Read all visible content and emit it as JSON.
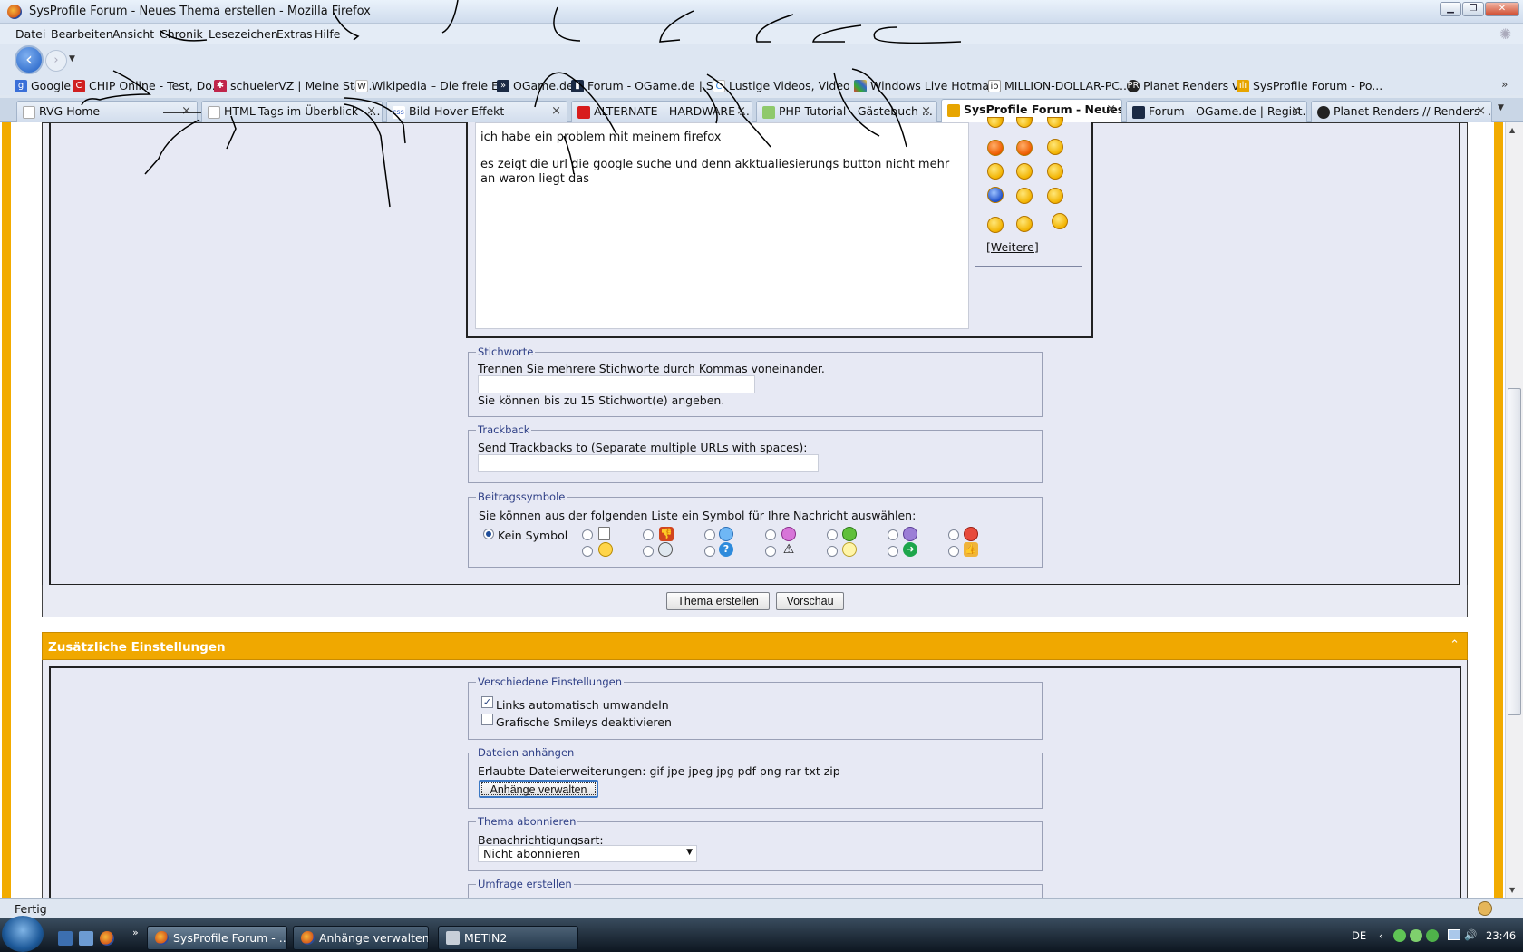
{
  "window": {
    "title": "SysProfile Forum - Neues Thema erstellen - Mozilla Firefox"
  },
  "menubar": [
    "Datei",
    "Bearbeiten",
    "Ansicht",
    "Chronik",
    "Lesezeichen",
    "Extras",
    "Hilfe"
  ],
  "bookmarks": [
    {
      "label": "Google",
      "icon": "google-icon",
      "color": "#3a6fd8"
    },
    {
      "label": "CHIP Online - Test, Do...",
      "icon": "chip-icon",
      "color": "#d02020"
    },
    {
      "label": "schuelerVZ | Meine Sta...",
      "icon": "schuelervz-icon",
      "color": "#c0254a"
    },
    {
      "label": "Wikipedia – Die freie E...",
      "icon": "wikipedia-icon",
      "color": "#444444"
    },
    {
      "label": "OGame.de",
      "icon": "ogame-icon",
      "color": "#1b2a44"
    },
    {
      "label": "Forum - OGame.de | S...",
      "icon": "ogame-forum-icon",
      "color": "#1b2a44"
    },
    {
      "label": "Lustige Videos, Video ...",
      "icon": "video-icon",
      "color": "#3c8be0"
    },
    {
      "label": "Windows Live Hotmail",
      "icon": "windows-icon",
      "color": "#2b7fd8"
    },
    {
      "label": "MILLION-DOLLAR-PC....",
      "icon": "milliondollar-icon",
      "color": "#222222"
    },
    {
      "label": "Planet Renders v3",
      "icon": "planet-renders-icon",
      "color": "#222222"
    },
    {
      "label": "SysProfile Forum - Po...",
      "icon": "sysprofile-icon",
      "color": "#e7a500"
    }
  ],
  "tabs": [
    {
      "label": "RVG Home",
      "active": false
    },
    {
      "label": "HTML-Tags im Überblick - ...",
      "active": false
    },
    {
      "label": "Bild-Hover-Effekt",
      "active": false
    },
    {
      "label": "ALTERNATE - HARDWARE ...",
      "active": false
    },
    {
      "label": "PHP Tutorial - Gästebuch ...",
      "active": false
    },
    {
      "label": "SysProfile Forum - Neues...",
      "active": true
    },
    {
      "label": "Forum - OGame.de | Regist...",
      "active": false
    },
    {
      "label": "Planet Renders // Renders -...",
      "active": false
    }
  ],
  "editor": {
    "line1": "ich habe ein problem mit meinem firefox",
    "line2": "es zeigt die url die google suche und denn akktualiesierungs button nicht mehr an waron liegt das",
    "more_smilies": "[Weitere]"
  },
  "tags": {
    "legend": "Stichworte",
    "hint": "Trennen Sie mehrere Stichworte durch Kommas voneinander.",
    "value": "",
    "limit": "Sie können bis zu 15 Stichwort(e) angeben."
  },
  "trackback": {
    "legend": "Trackback",
    "label": "Send Trackbacks to (Separate multiple URLs with spaces):",
    "value": ""
  },
  "post_icons": {
    "legend": "Beitragssymbole",
    "hint": "Sie können aus der folgenden Liste ein Symbol für Ihre Nachricht auswählen:",
    "none_label": "Kein Symbol",
    "selected": "Kein Symbol"
  },
  "buttons": {
    "submit": "Thema erstellen",
    "preview": "Vorschau"
  },
  "extra": {
    "header": "Zusätzliche Einstellungen",
    "collapse": "⌃",
    "misc": {
      "legend": "Verschiedene Einstellungen",
      "opt1": "Links automatisch umwandeln",
      "opt1_checked": true,
      "opt2": "Grafische Smileys deaktivieren",
      "opt2_checked": false
    },
    "attach": {
      "legend": "Dateien anhängen",
      "allowed": "Erlaubte Dateierweiterungen: gif jpe jpeg jpg pdf png rar txt zip",
      "button": "Anhänge verwalten"
    },
    "subscribe": {
      "legend": "Thema abonnieren",
      "label": "Benachrichtigungsart:",
      "selected": "Nicht abonnieren"
    },
    "poll": {
      "legend": "Umfrage erstellen"
    }
  },
  "status": "Fertig",
  "taskbar": {
    "tasks": [
      "SysProfile Forum - ...",
      "Anhänge verwalten ...",
      "METIN2"
    ],
    "lang": "DE",
    "clock": "23:46"
  },
  "colors": {
    "accent": "#f0a800",
    "legend": "#2e3f86"
  }
}
